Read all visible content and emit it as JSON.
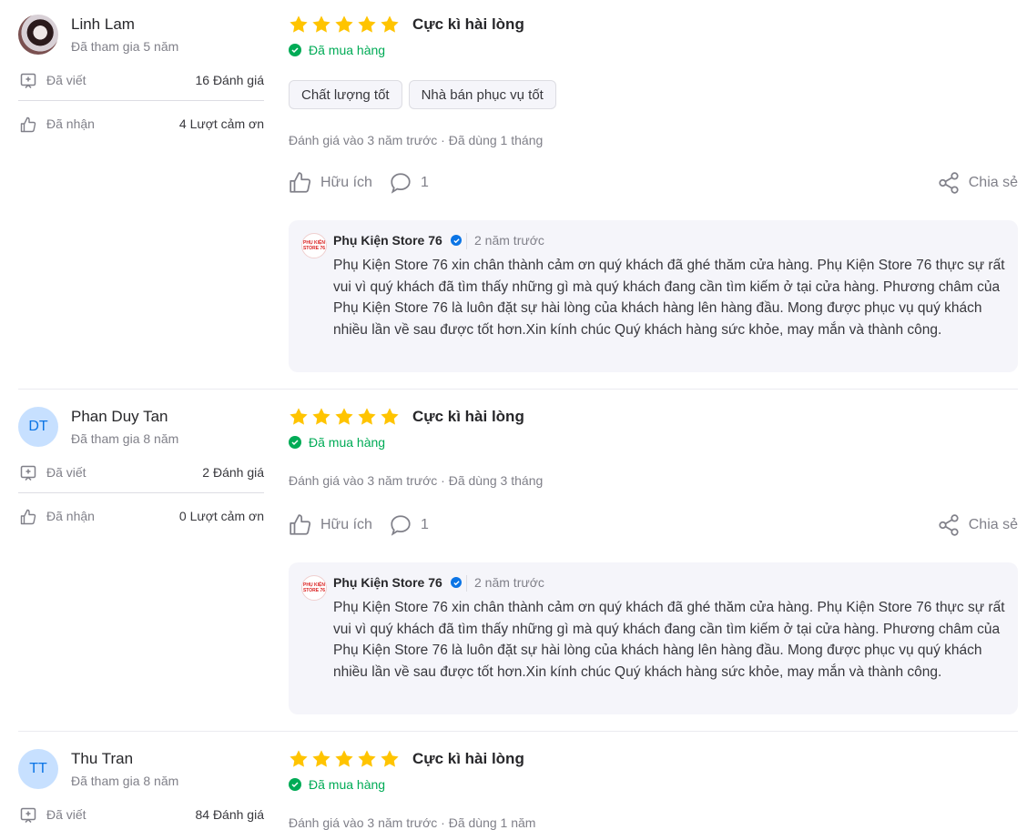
{
  "reviews": [
    {
      "user": {
        "name": "Linh Lam",
        "initials": "",
        "avatar_type": "photo",
        "joined": "Đã tham gia 5 năm",
        "written_label": "Đã viết",
        "written_value": "16 Đánh giá",
        "received_label": "Đã nhận",
        "received_value": "4 Lượt cảm ơn"
      },
      "rating": 5,
      "title": "Cực kì hài lòng",
      "purchased": "Đã mua hàng",
      "chips": [
        "Chất lượng tốt",
        "Nhà bán phục vụ tốt"
      ],
      "meta": "Đánh giá vào 3 năm trước · Đã dùng 1 tháng",
      "helpful": "Hữu ích",
      "comments": "1",
      "share": "Chia sẻ",
      "reply": {
        "seller": "Phụ Kiện Store 76",
        "logo_text": "PHỤ KIỆN STORE 76",
        "time": "2 năm trước",
        "text": "Phụ Kiện Store 76 xin chân thành cảm ơn quý khách đã ghé thăm cửa hàng. Phụ Kiện Store 76 thực sự rất vui vì quý khách đã tìm thấy những gì mà quý khách đang cần tìm kiếm ở tại cửa hàng. Phương châm của Phụ Kiện Store 76 là luôn đặt sự hài lòng của khách hàng lên hàng đầu. Mong được phục vụ quý khách nhiều lần về sau được tốt hơn.Xin kính chúc Quý khách hàng sức khỏe, may mắn và thành công."
      }
    },
    {
      "user": {
        "name": "Phan Duy Tan",
        "initials": "DT",
        "avatar_type": "initials",
        "joined": "Đã tham gia 8 năm",
        "written_label": "Đã viết",
        "written_value": "2 Đánh giá",
        "received_label": "Đã nhận",
        "received_value": "0 Lượt cảm ơn"
      },
      "rating": 5,
      "title": "Cực kì hài lòng",
      "purchased": "Đã mua hàng",
      "chips": [],
      "meta": "Đánh giá vào 3 năm trước · Đã dùng 3 tháng",
      "helpful": "Hữu ích",
      "comments": "1",
      "share": "Chia sẻ",
      "reply": {
        "seller": "Phụ Kiện Store 76",
        "logo_text": "PHỤ KIỆN STORE 76",
        "time": "2 năm trước",
        "text": "Phụ Kiện Store 76 xin chân thành cảm ơn quý khách đã ghé thăm cửa hàng. Phụ Kiện Store 76 thực sự rất vui vì quý khách đã tìm thấy những gì mà quý khách đang cần tìm kiếm ở tại cửa hàng. Phương châm của Phụ Kiện Store 76 là luôn đặt sự hài lòng của khách hàng lên hàng đầu. Mong được phục vụ quý khách nhiều lần về sau được tốt hơn.Xin kính chúc Quý khách hàng sức khỏe, may mắn và thành công."
      }
    },
    {
      "user": {
        "name": "Thu Tran",
        "initials": "TT",
        "avatar_type": "initials",
        "joined": "Đã tham gia 8 năm",
        "written_label": "Đã viết",
        "written_value": "84 Đánh giá",
        "received_label": "",
        "received_value": ""
      },
      "rating": 5,
      "title": "Cực kì hài lòng",
      "purchased": "Đã mua hàng",
      "chips": [],
      "meta": "Đánh giá vào 3 năm trước · Đã dùng 1 năm",
      "helpful": "",
      "comments": "",
      "share": "",
      "reply": null
    }
  ],
  "colors": {
    "star": "#ffc400",
    "green": "#00ab56",
    "blue": "#0b74e5",
    "muted": "#808089",
    "reply_bg": "#f5f5fa"
  }
}
